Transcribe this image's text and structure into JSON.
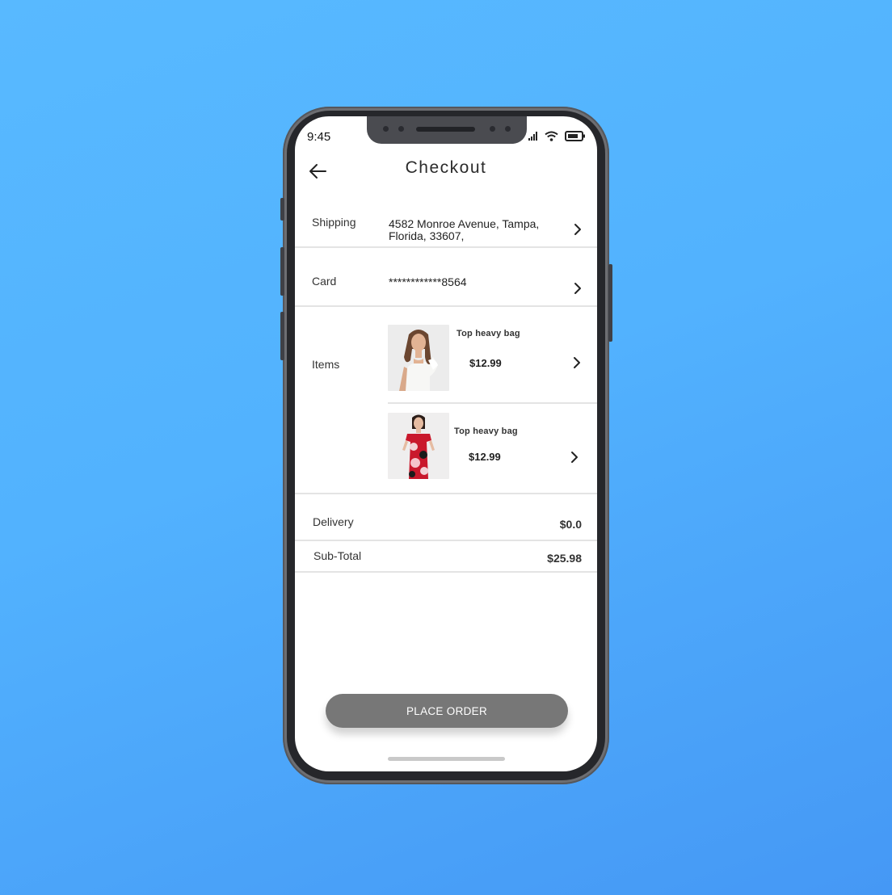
{
  "status_bar": {
    "time": "9:45",
    "icons": [
      "signal-icon",
      "wifi-icon",
      "battery-icon"
    ]
  },
  "header": {
    "title": "Checkout",
    "back_icon": "arrow-left-icon"
  },
  "shipping": {
    "label": "Shipping",
    "address_line1": "4582 Monroe Avenue, Tampa,",
    "address_line2": "Florida, 33607,"
  },
  "card": {
    "label": "Card",
    "number": "************8564"
  },
  "items": {
    "label": "Items",
    "list": [
      {
        "name": "Top heavy bag",
        "price": "$12.99",
        "image": "woman-white-top-photo"
      },
      {
        "name": "Top heavy bag",
        "price": "$12.99",
        "image": "woman-floral-dress-photo"
      }
    ]
  },
  "delivery": {
    "label": "Delivery",
    "amount": "$0.0"
  },
  "subtotal": {
    "label": "Sub-Total",
    "amount": "$25.98"
  },
  "place_order": {
    "label": "PLACE ORDER"
  },
  "colors": {
    "background": "#52b2fe",
    "button": "#777777",
    "divider": "#e4e4e4"
  }
}
